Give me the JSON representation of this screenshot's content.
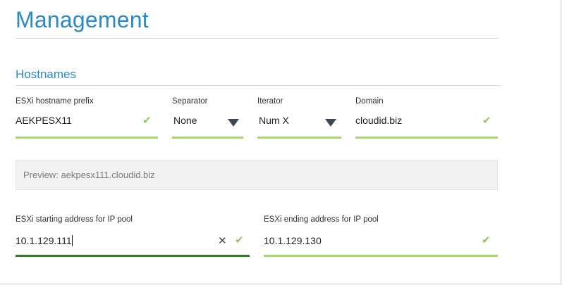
{
  "page": {
    "title": "Management"
  },
  "hostnames": {
    "section_title": "Hostnames",
    "prefix": {
      "label": "ESXi hostname prefix",
      "value": "AEKPESX11"
    },
    "separator": {
      "label": "Separator",
      "value": "None"
    },
    "iterator": {
      "label": "Iterator",
      "value": "Num X"
    },
    "domain": {
      "label": "Domain",
      "value": "cloudid.biz"
    },
    "preview": "Preview: aekpesx111.cloudid.biz"
  },
  "ip_pool": {
    "start": {
      "label": "ESXi starting address for IP pool",
      "value": "10.1.129.111"
    },
    "end": {
      "label": "ESXi ending address for IP pool",
      "value": "10.1.129.130"
    }
  },
  "icons": {
    "valid": "check-icon",
    "dropdown": "caret-down-icon",
    "clear": "clear-icon"
  },
  "colors": {
    "accent": "#2a8ac9",
    "valid_underline": "#a8d66e",
    "active_underline": "#2f7d2a",
    "check": "#8cc85a"
  }
}
